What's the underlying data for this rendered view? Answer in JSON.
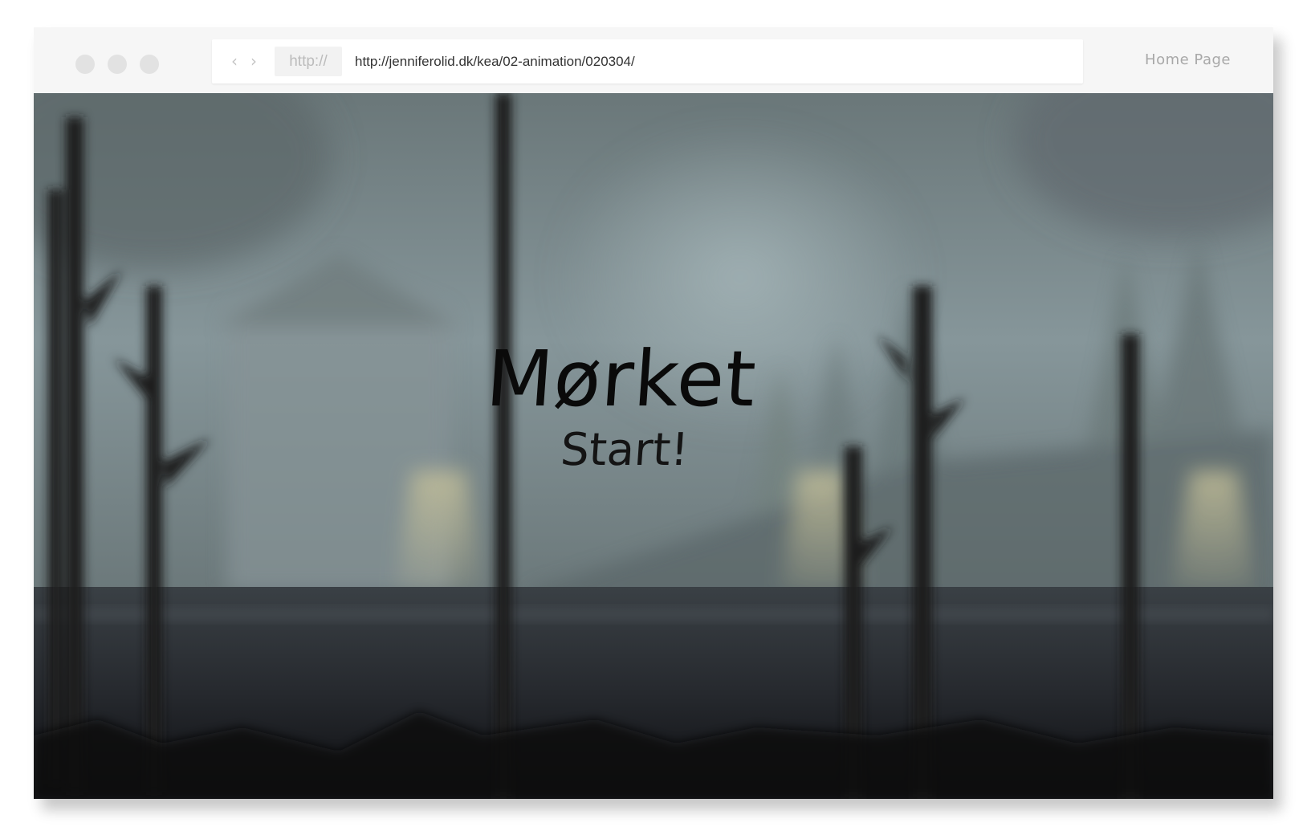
{
  "browser": {
    "nav": {
      "back_glyph": "‹",
      "forward_glyph": "›"
    },
    "address": {
      "scheme": "http://",
      "url": "http://jenniferolid.dk/kea/02-animation/020304/"
    },
    "home_link": "Home Page"
  },
  "page": {
    "title": "Mørket",
    "start_label": "Start!"
  },
  "icons": {
    "back": "chevron-left-icon",
    "forward": "chevron-right-icon"
  },
  "colors": {
    "titlebar": "#f6f6f6",
    "window_dot": "#e2e2e2",
    "scene_sky": "#7f8d90",
    "scene_ground": "#25282d",
    "text": "#0a0a0a"
  }
}
